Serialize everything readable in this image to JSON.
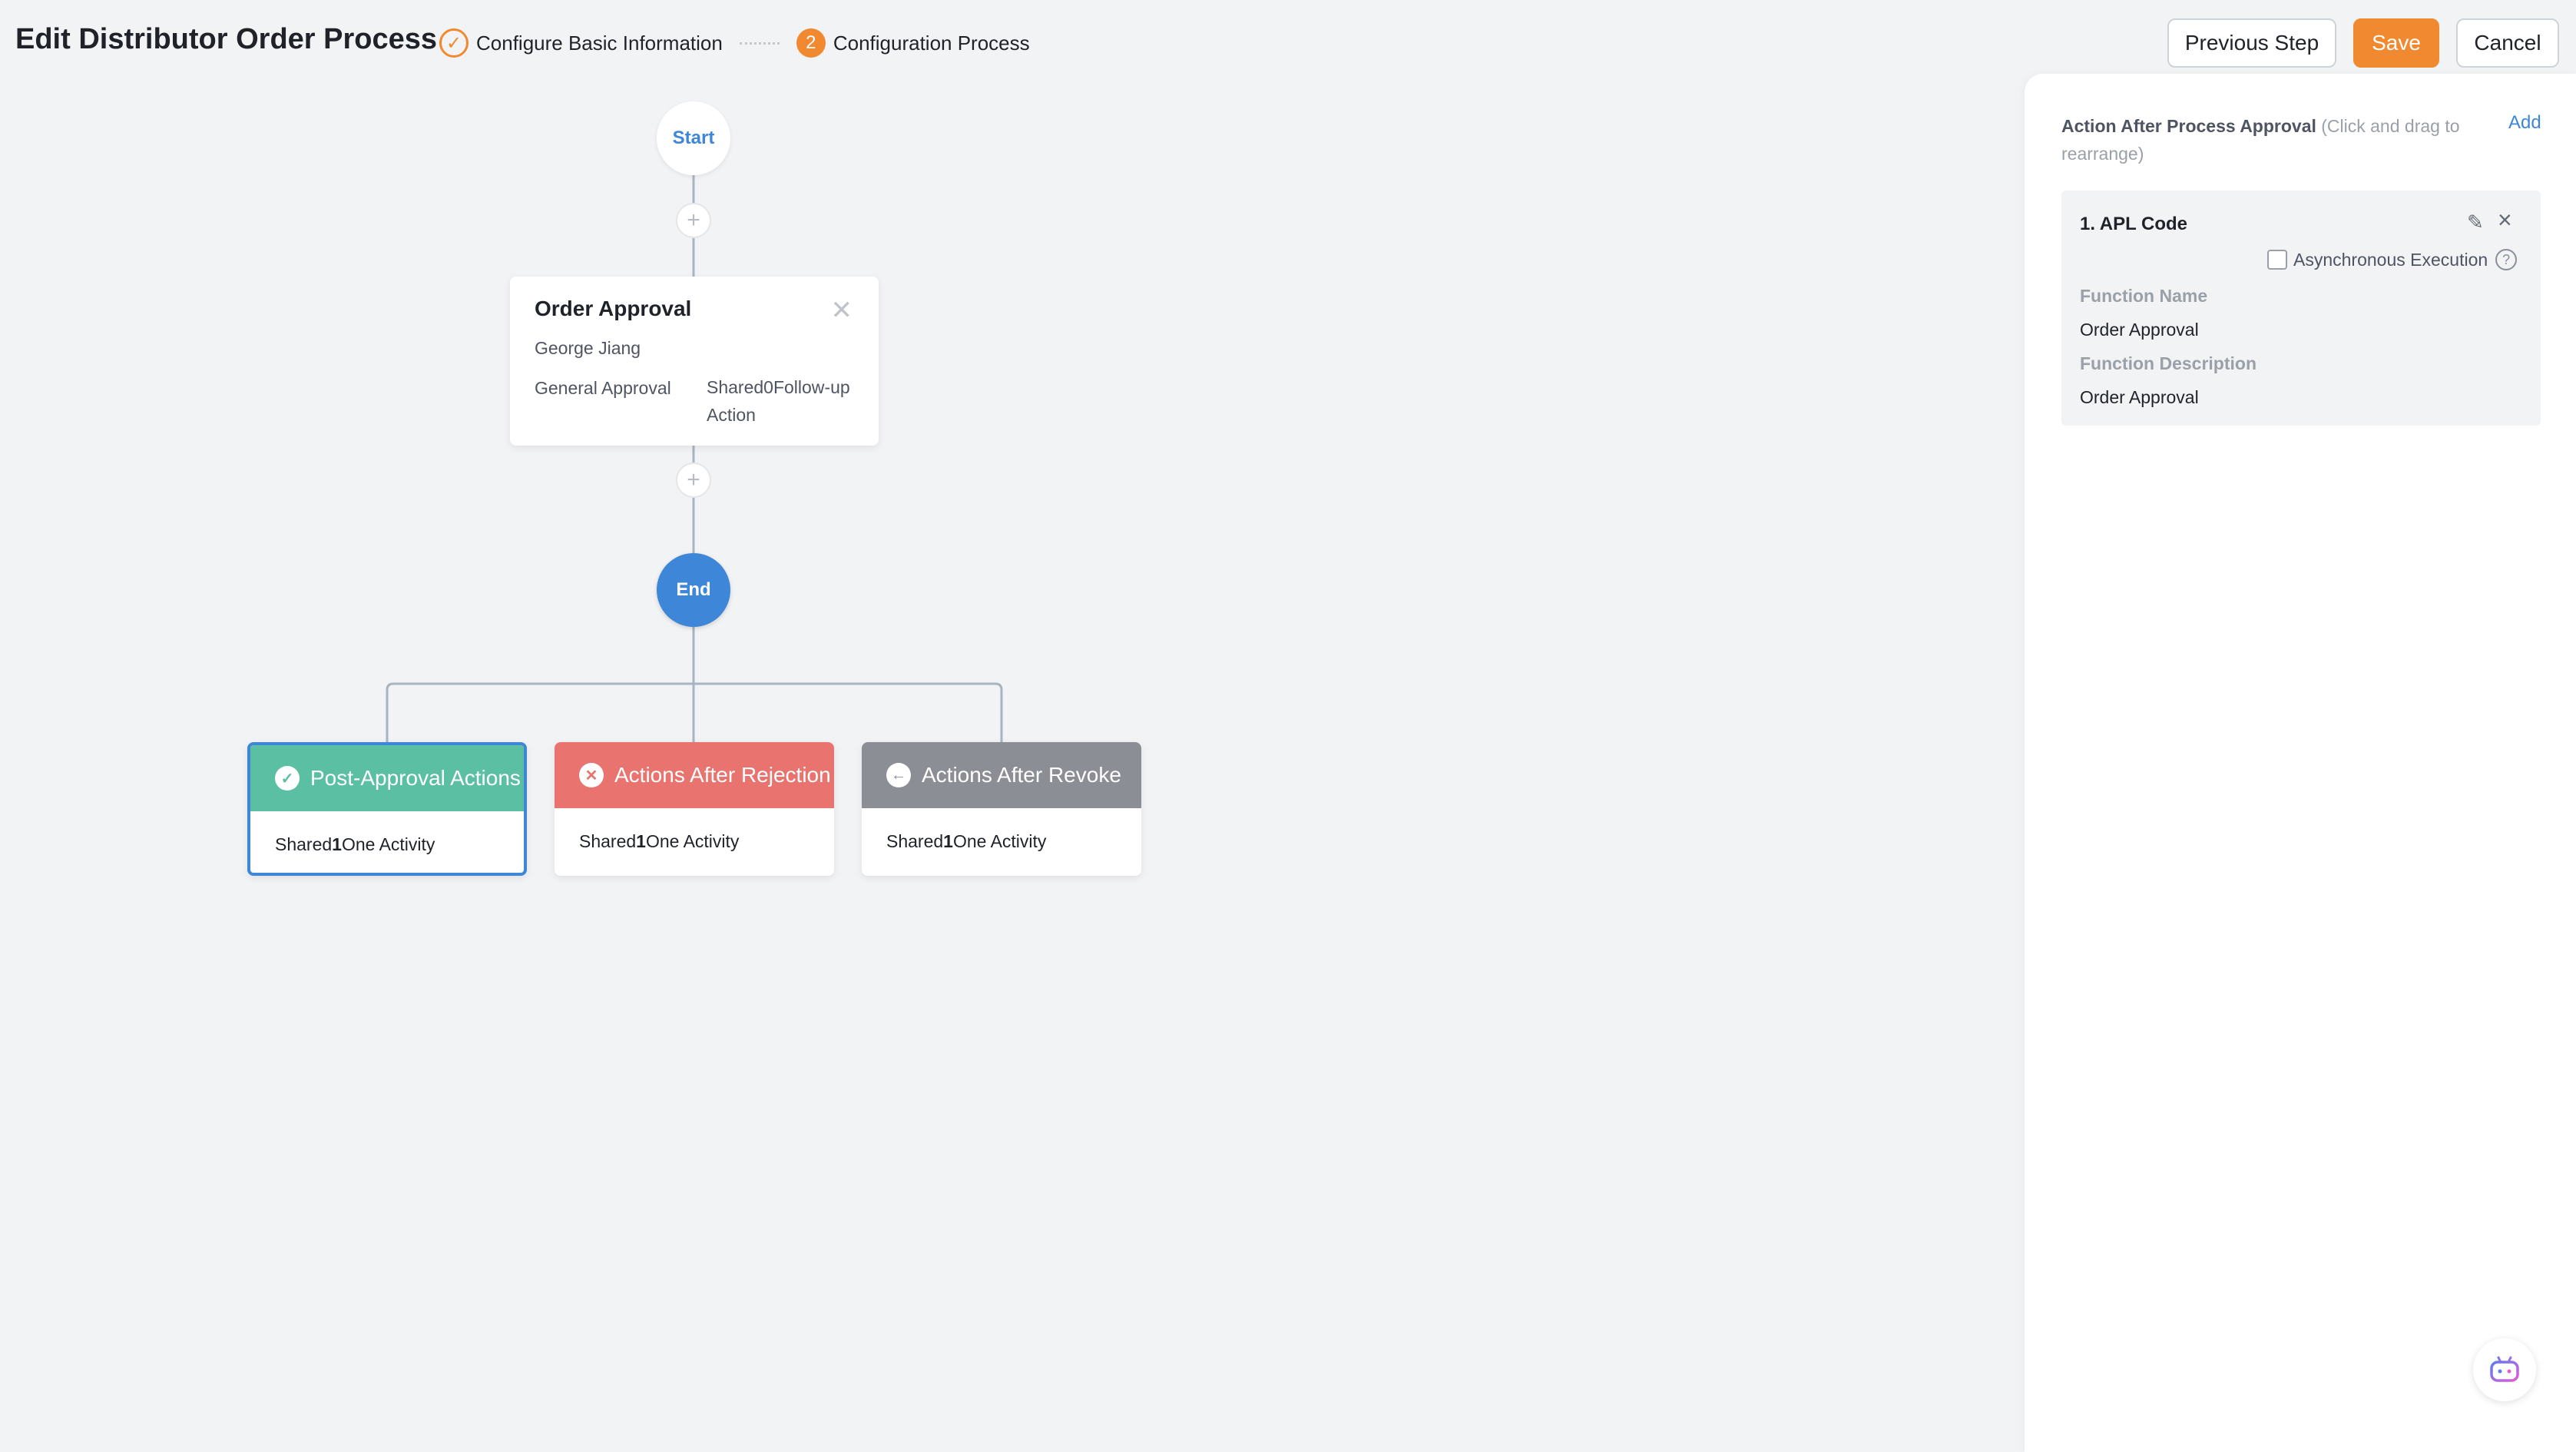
{
  "header": {
    "title": "Edit Distributor Order Process",
    "steps": [
      {
        "number": "1",
        "label": "Configure Basic Information",
        "state": "done"
      },
      {
        "number": "2",
        "label": "Configuration Process",
        "state": "active"
      }
    ],
    "buttons": {
      "previous": "Previous Step",
      "save": "Save",
      "cancel": "Cancel"
    }
  },
  "flow": {
    "start_label": "Start",
    "end_label": "End",
    "approval": {
      "title": "Order Approval",
      "assignee": "George Jiang",
      "type": "General Approval",
      "follow_up": "Shared0Follow-up Action"
    },
    "actions": [
      {
        "title": "Post-Approval Actions",
        "prefix": "Shared",
        "count": "1",
        "suffix": "One Activity",
        "color": "#5bbfa4",
        "icon": "check-circle-icon"
      },
      {
        "title": "Actions After Rejection",
        "prefix": "Shared",
        "count": "1",
        "suffix": "One Activity",
        "color": "#e8736f",
        "icon": "x-circle-icon"
      },
      {
        "title": "Actions After Revoke",
        "prefix": "Shared",
        "count": "1",
        "suffix": "One Activity",
        "color": "#8c8e95",
        "icon": "back-arrow-icon"
      }
    ]
  },
  "panel": {
    "heading": "Action After Process Approval",
    "hint": "(Click and drag to rearrange)",
    "add_label": "Add",
    "item": {
      "title": "1. APL Code",
      "async_label": "Asynchronous Execution",
      "function_name_label": "Function Name",
      "function_name": "Order Approval",
      "function_desc_label": "Function Description",
      "function_desc": "Order Approval"
    }
  },
  "colors": {
    "accent": "#f0892f",
    "link": "#3d86d8",
    "success": "#5bbfa4",
    "danger": "#e8736f",
    "neutral": "#8c8e95"
  }
}
